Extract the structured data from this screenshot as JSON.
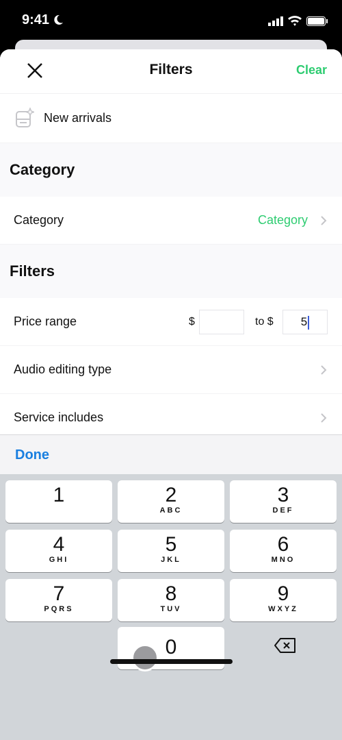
{
  "status_bar": {
    "time": "9:41"
  },
  "header": {
    "title": "Filters",
    "clear_label": "Clear"
  },
  "new_arrivals": {
    "label": "New arrivals"
  },
  "sections": [
    {
      "title": "Category",
      "rows": [
        {
          "label": "Category",
          "value": "Category"
        }
      ]
    },
    {
      "title": "Filters",
      "rows": [
        {
          "label": "Price range",
          "min_prefix": "$",
          "min_value": "",
          "max_prefix": "to $",
          "max_value": "5"
        },
        {
          "label": "Audio editing type"
        },
        {
          "label": "Service includes"
        }
      ]
    }
  ],
  "accessory": {
    "done_label": "Done"
  },
  "keyboard": {
    "keys": [
      {
        "n": "1",
        "l": ""
      },
      {
        "n": "2",
        "l": "ABC"
      },
      {
        "n": "3",
        "l": "DEF"
      },
      {
        "n": "4",
        "l": "GHI"
      },
      {
        "n": "5",
        "l": "JKL"
      },
      {
        "n": "6",
        "l": "MNO"
      },
      {
        "n": "7",
        "l": "PQRS"
      },
      {
        "n": "8",
        "l": "TUV"
      },
      {
        "n": "9",
        "l": "WXYZ"
      },
      {
        "n": "0",
        "l": ""
      }
    ]
  },
  "colors": {
    "accent_green": "#2ecc71",
    "done_blue": "#1a7fe0"
  }
}
